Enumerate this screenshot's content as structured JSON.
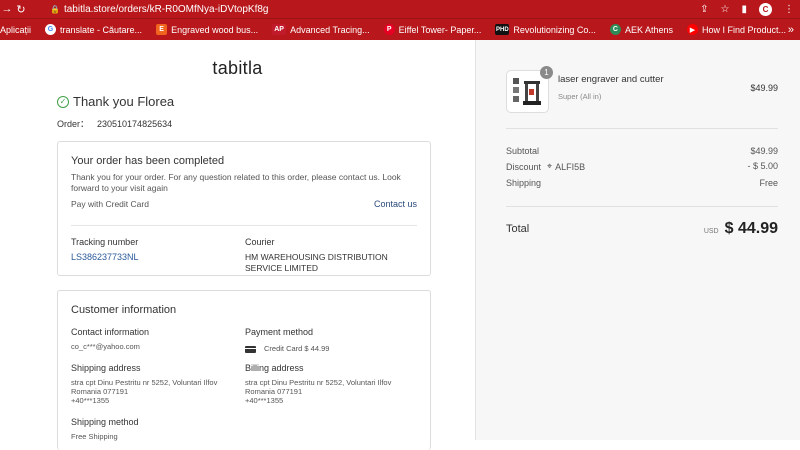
{
  "browser": {
    "url": "tabitla.store/orders/kR-R0OMfNya-iDVtopKf8g",
    "avatar": "C",
    "bookmarks": [
      {
        "label": "Aplicații",
        "color": "#b8171b"
      },
      {
        "label": "translate - Căutare...",
        "color": "#4285f4"
      },
      {
        "label": "Engraved wood bus...",
        "color": "#f1641e"
      },
      {
        "label": "Advanced Tracing...",
        "color": "#c11b2b"
      },
      {
        "label": "Eiffel Tower- Paper...",
        "color": "#e60023"
      },
      {
        "label": "Revolutionizing Co...",
        "color": "#111111"
      },
      {
        "label": "AEK Athens",
        "color": "#2e8b57"
      },
      {
        "label": "How I Find Product...",
        "color": "#ff0000"
      }
    ]
  },
  "brand": "tabitla",
  "thanks": "Thank you Florea",
  "order": {
    "label": "Order：",
    "number": "230510174825634"
  },
  "status_card": {
    "title": "Your order has been completed",
    "message": "Thank you for your order. For any question related to this order, please contact us. Look forward to your visit again",
    "payment": "Pay with Credit Card",
    "contact_link": "Contact us",
    "tracking_label": "Tracking number",
    "tracking_number": "LS386237733NL",
    "courier_label": "Courier",
    "courier": "HM WAREHOUSING DISTRIBUTION SERVICE LIMITED"
  },
  "customer": {
    "title": "Customer information",
    "contact_label": "Contact information",
    "contact": "co_c***@yahoo.com",
    "payment_label": "Payment method",
    "payment": "Credit Card $ 44.99",
    "shipping_label": "Shipping address",
    "shipping_address": "stra cpt Dinu Pestritu nr 5252, Voluntari Ilfov",
    "shipping_city": "Romania 077191",
    "shipping_phone": "+40***1355",
    "billing_label": "Billing address",
    "billing_address": "stra cpt Dinu Pestritu nr 5252, Voluntari Ilfov",
    "billing_city": "Romania 077191",
    "billing_phone": "+40***1355",
    "method_label": "Shipping method",
    "method": "Free Shipping"
  },
  "summary": {
    "product_name": "laser engraver and cutter",
    "variant": "Super (All in)",
    "quantity": "1",
    "price": "$49.99",
    "subtotal_label": "Subtotal",
    "subtotal": "$49.99",
    "discount_label": "Discount",
    "discount_code": "ALFI5B",
    "discount": "- $ 5.00",
    "shipping_label": "Shipping",
    "shipping": "Free",
    "total_label": "Total",
    "currency": "USD",
    "total": "$ 44.99"
  }
}
